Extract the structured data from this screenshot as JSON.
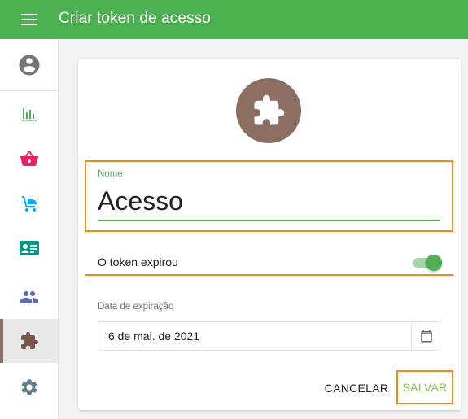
{
  "header": {
    "title": "Criar token de acesso",
    "menu_icon": "menu-icon"
  },
  "sidebar": {
    "items": [
      {
        "name": "account-icon",
        "color": "#757575"
      },
      {
        "name": "bar-chart-icon",
        "color": "#4caf50"
      },
      {
        "name": "shopping-basket-icon",
        "color": "#e91e63"
      },
      {
        "name": "hand-truck-icon",
        "color": "#03a9f4"
      },
      {
        "name": "contact-card-icon",
        "color": "#009688"
      },
      {
        "name": "people-icon",
        "color": "#5c6bc0"
      },
      {
        "name": "puzzle-icon",
        "color": "#795548",
        "active": true
      },
      {
        "name": "gear-icon",
        "color": "#607d8b"
      }
    ]
  },
  "form": {
    "avatar_icon": "puzzle-icon",
    "avatar_color": "#8d6e63",
    "name_label": "Nome",
    "name_value": "Acesso",
    "toggle_label": "O token expirou",
    "toggle_on": true,
    "date_label": "Data de expiração",
    "date_value": "6 de mai. de 2021",
    "calendar_icon": "calendar-icon"
  },
  "actions": {
    "cancel_label": "CANCELAR",
    "save_label": "SALVAR"
  },
  "colors": {
    "primary": "#4caf50",
    "accent": "#8bc34a",
    "highlight": "#ef8a17"
  }
}
